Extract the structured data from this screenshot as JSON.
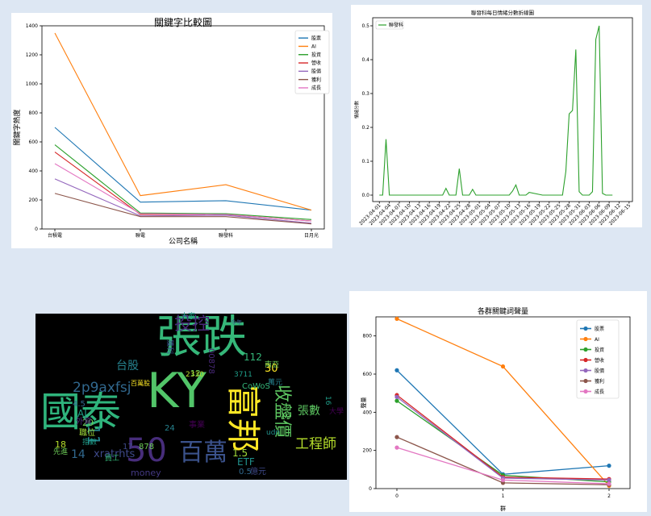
{
  "chart_data": [
    {
      "type": "line",
      "title": "關鍵字比較圖",
      "xlabel": "公司名稱",
      "ylabel": "關鍵字熱度",
      "categories": [
        "台積電",
        "聯電",
        "聯發科",
        "日月光"
      ],
      "ylim": [
        0,
        1400
      ],
      "yticks": [
        0,
        200,
        400,
        600,
        800,
        1000,
        1200,
        1400
      ],
      "legend_position": "top-right",
      "series": [
        {
          "name": "股票",
          "color": "#1f77b4",
          "values": [
            700,
            185,
            195,
            130
          ]
        },
        {
          "name": "AI",
          "color": "#ff7f0e",
          "values": [
            1350,
            230,
            305,
            130
          ]
        },
        {
          "name": "投資",
          "color": "#2ca02c",
          "values": [
            580,
            110,
            105,
            65
          ]
        },
        {
          "name": "營收",
          "color": "#d62728",
          "values": [
            530,
            100,
            100,
            55
          ]
        },
        {
          "name": "股價",
          "color": "#9467bd",
          "values": [
            345,
            90,
            95,
            40
          ]
        },
        {
          "name": "獲利",
          "color": "#8c564b",
          "values": [
            245,
            85,
            85,
            35
          ]
        },
        {
          "name": "成長",
          "color": "#e377c2",
          "values": [
            450,
            105,
            100,
            55
          ]
        }
      ]
    },
    {
      "type": "line",
      "title": "聯發科每日情緒分數折線圖",
      "xlabel": "",
      "ylabel": "情緒分數",
      "ylim": [
        0,
        0.5
      ],
      "yticks": [
        0.0,
        0.1,
        0.2,
        0.3,
        0.4,
        0.5
      ],
      "date_ticks": [
        "2023-04-01",
        "2023-04-04",
        "2023-04-07",
        "2023-04-10",
        "2023-04-13",
        "2023-04-16",
        "2023-04-19",
        "2023-04-22",
        "2023-04-25",
        "2023-04-28",
        "2023-05-01",
        "2023-05-04",
        "2023-05-07",
        "2023-05-10",
        "2023-05-13",
        "2023-05-16",
        "2023-05-19",
        "2023-05-22",
        "2023-05-25",
        "2023-05-28",
        "2023-05-31",
        "2023-06-03",
        "2023-06-06",
        "2023-06-09",
        "2023-06-12",
        "2023-06-15"
      ],
      "legend_position": "top-left",
      "series": [
        {
          "name": "聯發科",
          "color": "#2ca02c",
          "x": [
            "2023-04-01",
            "2023-04-02",
            "2023-04-03",
            "2023-04-04",
            "2023-04-05",
            "2023-04-10",
            "2023-04-15",
            "2023-04-20",
            "2023-04-21",
            "2023-04-22",
            "2023-04-23",
            "2023-04-24",
            "2023-04-25",
            "2023-04-26",
            "2023-04-27",
            "2023-04-28",
            "2023-04-29",
            "2023-04-30",
            "2023-05-01",
            "2023-05-05",
            "2023-05-10",
            "2023-05-11",
            "2023-05-12",
            "2023-05-13",
            "2023-05-14",
            "2023-05-15",
            "2023-05-16",
            "2023-05-20",
            "2023-05-25",
            "2023-05-26",
            "2023-05-27",
            "2023-05-28",
            "2023-05-29",
            "2023-05-30",
            "2023-05-31",
            "2023-06-01",
            "2023-06-03",
            "2023-06-04",
            "2023-06-05",
            "2023-06-06",
            "2023-06-07",
            "2023-06-08",
            "2023-06-09",
            "2023-06-10"
          ],
          "values": [
            0.0,
            0.0,
            0.165,
            0.0,
            0.0,
            0.0,
            0.0,
            0.0,
            0.02,
            0.0,
            0.0,
            0.0,
            0.078,
            0.0,
            0.0,
            0.0,
            0.017,
            0.0,
            0.0,
            0.0,
            0.0,
            0.012,
            0.03,
            0.0,
            0.0,
            0.0,
            0.008,
            0.0,
            0.0,
            0.0,
            0.07,
            0.24,
            0.25,
            0.43,
            0.01,
            0.0,
            0.0,
            0.01,
            0.46,
            0.5,
            0.005,
            0.0,
            0.0,
            0.0
          ]
        }
      ]
    },
    {
      "type": "line",
      "title": "各群關鍵詞聲量",
      "xlabel": "群",
      "ylabel": "聲量",
      "categories": [
        "0",
        "1",
        "2"
      ],
      "ylim": [
        0,
        900
      ],
      "yticks": [
        0,
        200,
        400,
        600,
        800
      ],
      "legend_position": "top-right",
      "series": [
        {
          "name": "股票",
          "color": "#1f77b4",
          "values": [
            620,
            75,
            120
          ]
        },
        {
          "name": "AI",
          "color": "#ff7f0e",
          "values": [
            890,
            640,
            15
          ]
        },
        {
          "name": "投資",
          "color": "#2ca02c",
          "values": [
            460,
            70,
            35
          ]
        },
        {
          "name": "營收",
          "color": "#d62728",
          "values": [
            490,
            60,
            50
          ]
        },
        {
          "name": "股價",
          "color": "#9467bd",
          "values": [
            480,
            55,
            45
          ]
        },
        {
          "name": "獲利",
          "color": "#8c564b",
          "values": [
            270,
            30,
            20
          ]
        },
        {
          "name": "成長",
          "color": "#e377c2",
          "values": [
            215,
            45,
            25
          ]
        }
      ]
    }
  ],
  "wordcloud": {
    "words": [
      {
        "t": "國泰",
        "c": "#2fb47c"
      },
      {
        "t": "張跌",
        "c": "#35b779"
      },
      {
        "t": "KY",
        "c": "#52c569"
      },
      {
        "t": "50",
        "c": "#472d7b"
      },
      {
        "t": "百萬",
        "c": "#3b528b"
      },
      {
        "t": "富邦",
        "c": "#fde725"
      },
      {
        "t": "投控",
        "c": "#482878"
      },
      {
        "t": "收盤價",
        "c": "#5ec962"
      },
      {
        "t": "工程師",
        "c": "#b5de2b"
      },
      {
        "t": "2p9axfsj",
        "c": "#31688e"
      },
      {
        "t": "台股",
        "c": "#26828e"
      },
      {
        "t": "張數",
        "c": "#5ec962"
      },
      {
        "t": "xratrhts",
        "c": "#3e4989"
      },
      {
        "t": "14",
        "c": "#31688e"
      },
      {
        "t": "money",
        "c": "#443983"
      },
      {
        "t": "ETF",
        "c": "#21918c"
      },
      {
        "t": "30",
        "c": "#fde725"
      },
      {
        "t": "AI",
        "c": "#1f9e89"
      },
      {
        "t": "112",
        "c": "#35b779"
      },
      {
        "t": "00878",
        "c": "#482878"
      },
      {
        "t": "12",
        "c": "#6ece58"
      },
      {
        "t": "萬元",
        "c": "#26828e"
      },
      {
        "t": "億元",
        "c": "#3e4989"
      },
      {
        "t": "大學",
        "c": "#440154"
      },
      {
        "t": "1.5",
        "c": "#a0da39"
      },
      {
        "t": "0.5",
        "c": "#31688e"
      },
      {
        "t": "11",
        "c": "#26828e"
      },
      {
        "t": "18",
        "c": "#b5de2b"
      },
      {
        "t": "4.5",
        "c": "#31688e"
      },
      {
        "t": "20",
        "c": "#6ece58"
      },
      {
        "t": "3711",
        "c": "#1f9e89"
      },
      {
        "t": "2330",
        "c": "#b5de2b"
      },
      {
        "t": "CoWoS",
        "c": "#35b779"
      },
      {
        "t": "百萬股",
        "c": "#fde725"
      },
      {
        "t": "udn",
        "c": "#21918c"
      },
      {
        "t": "外資",
        "c": "#482878"
      },
      {
        "t": "先進",
        "c": "#6ece58"
      },
      {
        "t": "職位",
        "c": "#a0da39"
      },
      {
        "t": "指數",
        "c": "#1f9e89"
      },
      {
        "t": "員工",
        "c": "#35b779"
      },
      {
        "t": "16",
        "c": "#1f9e89"
      },
      {
        "t": "19",
        "c": "#5ec962"
      },
      {
        "t": "24",
        "c": "#26828e"
      },
      {
        "t": "17",
        "c": "#3e4989"
      },
      {
        "t": "878",
        "c": "#6ece58"
      },
      {
        "t": "事業",
        "c": "#440154"
      },
      {
        "t": "南亞",
        "c": "#6ece58"
      },
      {
        "t": "獲利",
        "c": "#3b528b"
      },
      {
        "t": "今年",
        "c": "#3b528b"
      },
      {
        "t": "大家",
        "c": "#1f9e89"
      }
    ]
  }
}
